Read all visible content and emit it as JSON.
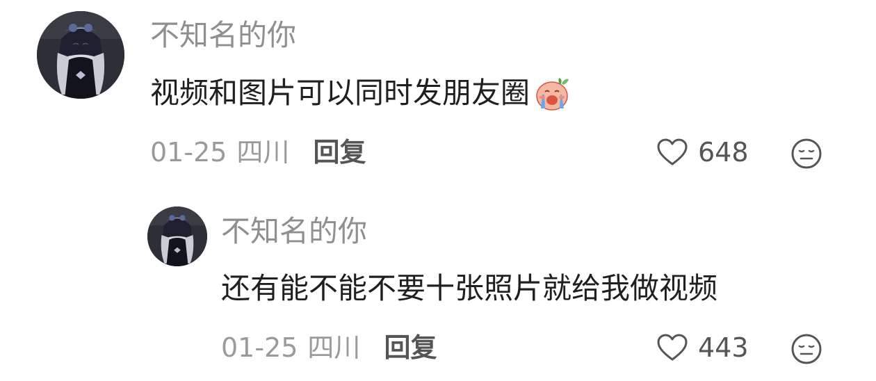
{
  "comments": [
    {
      "author": "不知名的你",
      "text": "视频和图片可以同时发朋友圈",
      "emoji": "crying-face-emoji",
      "time": "01-25",
      "location": "四川",
      "reply_label": "回复",
      "likes": "648"
    },
    {
      "author": "不知名的你",
      "text": "还有能不能不要十张照片就给我做视频",
      "time": "01-25",
      "location": "四川",
      "reply_label": "回复",
      "likes": "443"
    }
  ],
  "colors": {
    "author": "#8f8f8f",
    "text": "#1f1f1f",
    "meta": "#9a9a9a",
    "action": "#555555"
  }
}
